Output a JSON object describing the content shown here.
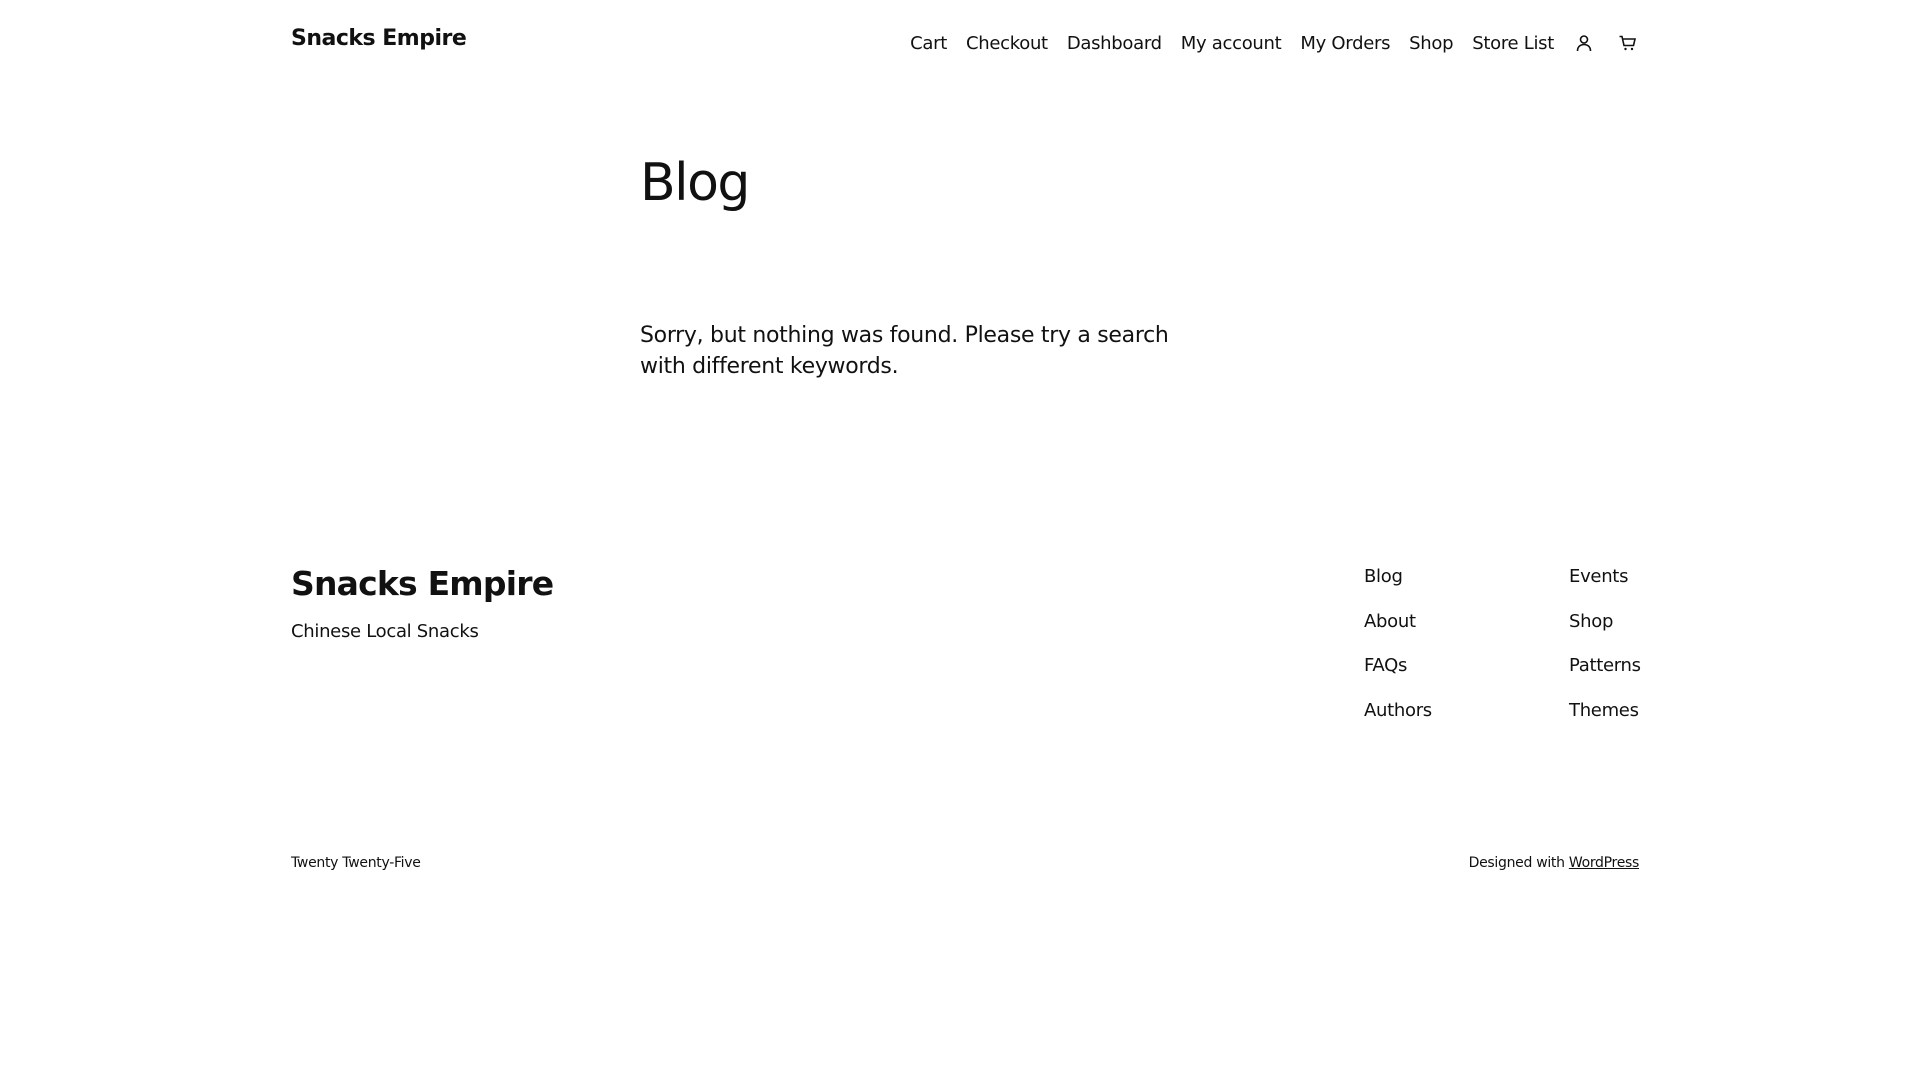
{
  "header": {
    "site_title": "Snacks Empire",
    "nav": [
      {
        "label": "Cart"
      },
      {
        "label": "Checkout"
      },
      {
        "label": "Dashboard"
      },
      {
        "label": "My account"
      },
      {
        "label": "My Orders"
      },
      {
        "label": "Shop"
      },
      {
        "label": "Store List"
      }
    ],
    "icons": [
      "account-icon",
      "cart-icon"
    ]
  },
  "main": {
    "title": "Blog",
    "message": "Sorry, but nothing was found. Please try a search with different keywords."
  },
  "footer": {
    "site_title": "Snacks Empire",
    "tagline": "Chinese Local Snacks",
    "links_col1": [
      {
        "label": "Blog"
      },
      {
        "label": "About"
      },
      {
        "label": "FAQs"
      },
      {
        "label": "Authors"
      }
    ],
    "links_col2": [
      {
        "label": "Events"
      },
      {
        "label": "Shop"
      },
      {
        "label": "Patterns"
      },
      {
        "label": "Themes"
      }
    ],
    "theme_credit": "Twenty Twenty-Five",
    "designed_with": "Designed with",
    "wordpress_link": "WordPress"
  }
}
